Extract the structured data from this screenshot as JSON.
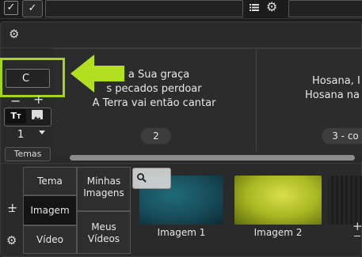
{
  "toolbar": {
    "check_icon": "checkmark-icon",
    "list_icon": "list-icon",
    "gear_icon": "gear-icon"
  },
  "panel": {
    "settings_icon": "gear-icon"
  },
  "search": {
    "value": "C"
  },
  "font_controls": {
    "minus": "−",
    "plus": "+",
    "size_value": "1",
    "themes_label": "Temas"
  },
  "slides": [
    {
      "lines": [
        "o a Sua graça",
        "s pecados perdoar",
        "A Terra vai então cantar"
      ],
      "number": "2"
    },
    {
      "lines": [
        "Hosana, I",
        "Hosana na"
      ],
      "number": "3 - co"
    }
  ],
  "tabs": {
    "tema": "Tema",
    "imagem": "Imagem",
    "video": "Vídeo",
    "minhas_imagens": [
      "Minhas",
      "Imagens"
    ],
    "meus_videos": [
      "Meus",
      "Vídeos"
    ]
  },
  "side_add": "+",
  "media": [
    {
      "label": "Imagem 1",
      "color": "#1c5a6a"
    },
    {
      "label": "Imagem 2",
      "color": "#b9c72a"
    }
  ],
  "media_controls": {
    "plus": "+",
    "minus": "−"
  },
  "colors": {
    "highlight": "#a4d61e",
    "arrow": "#b2e021"
  }
}
